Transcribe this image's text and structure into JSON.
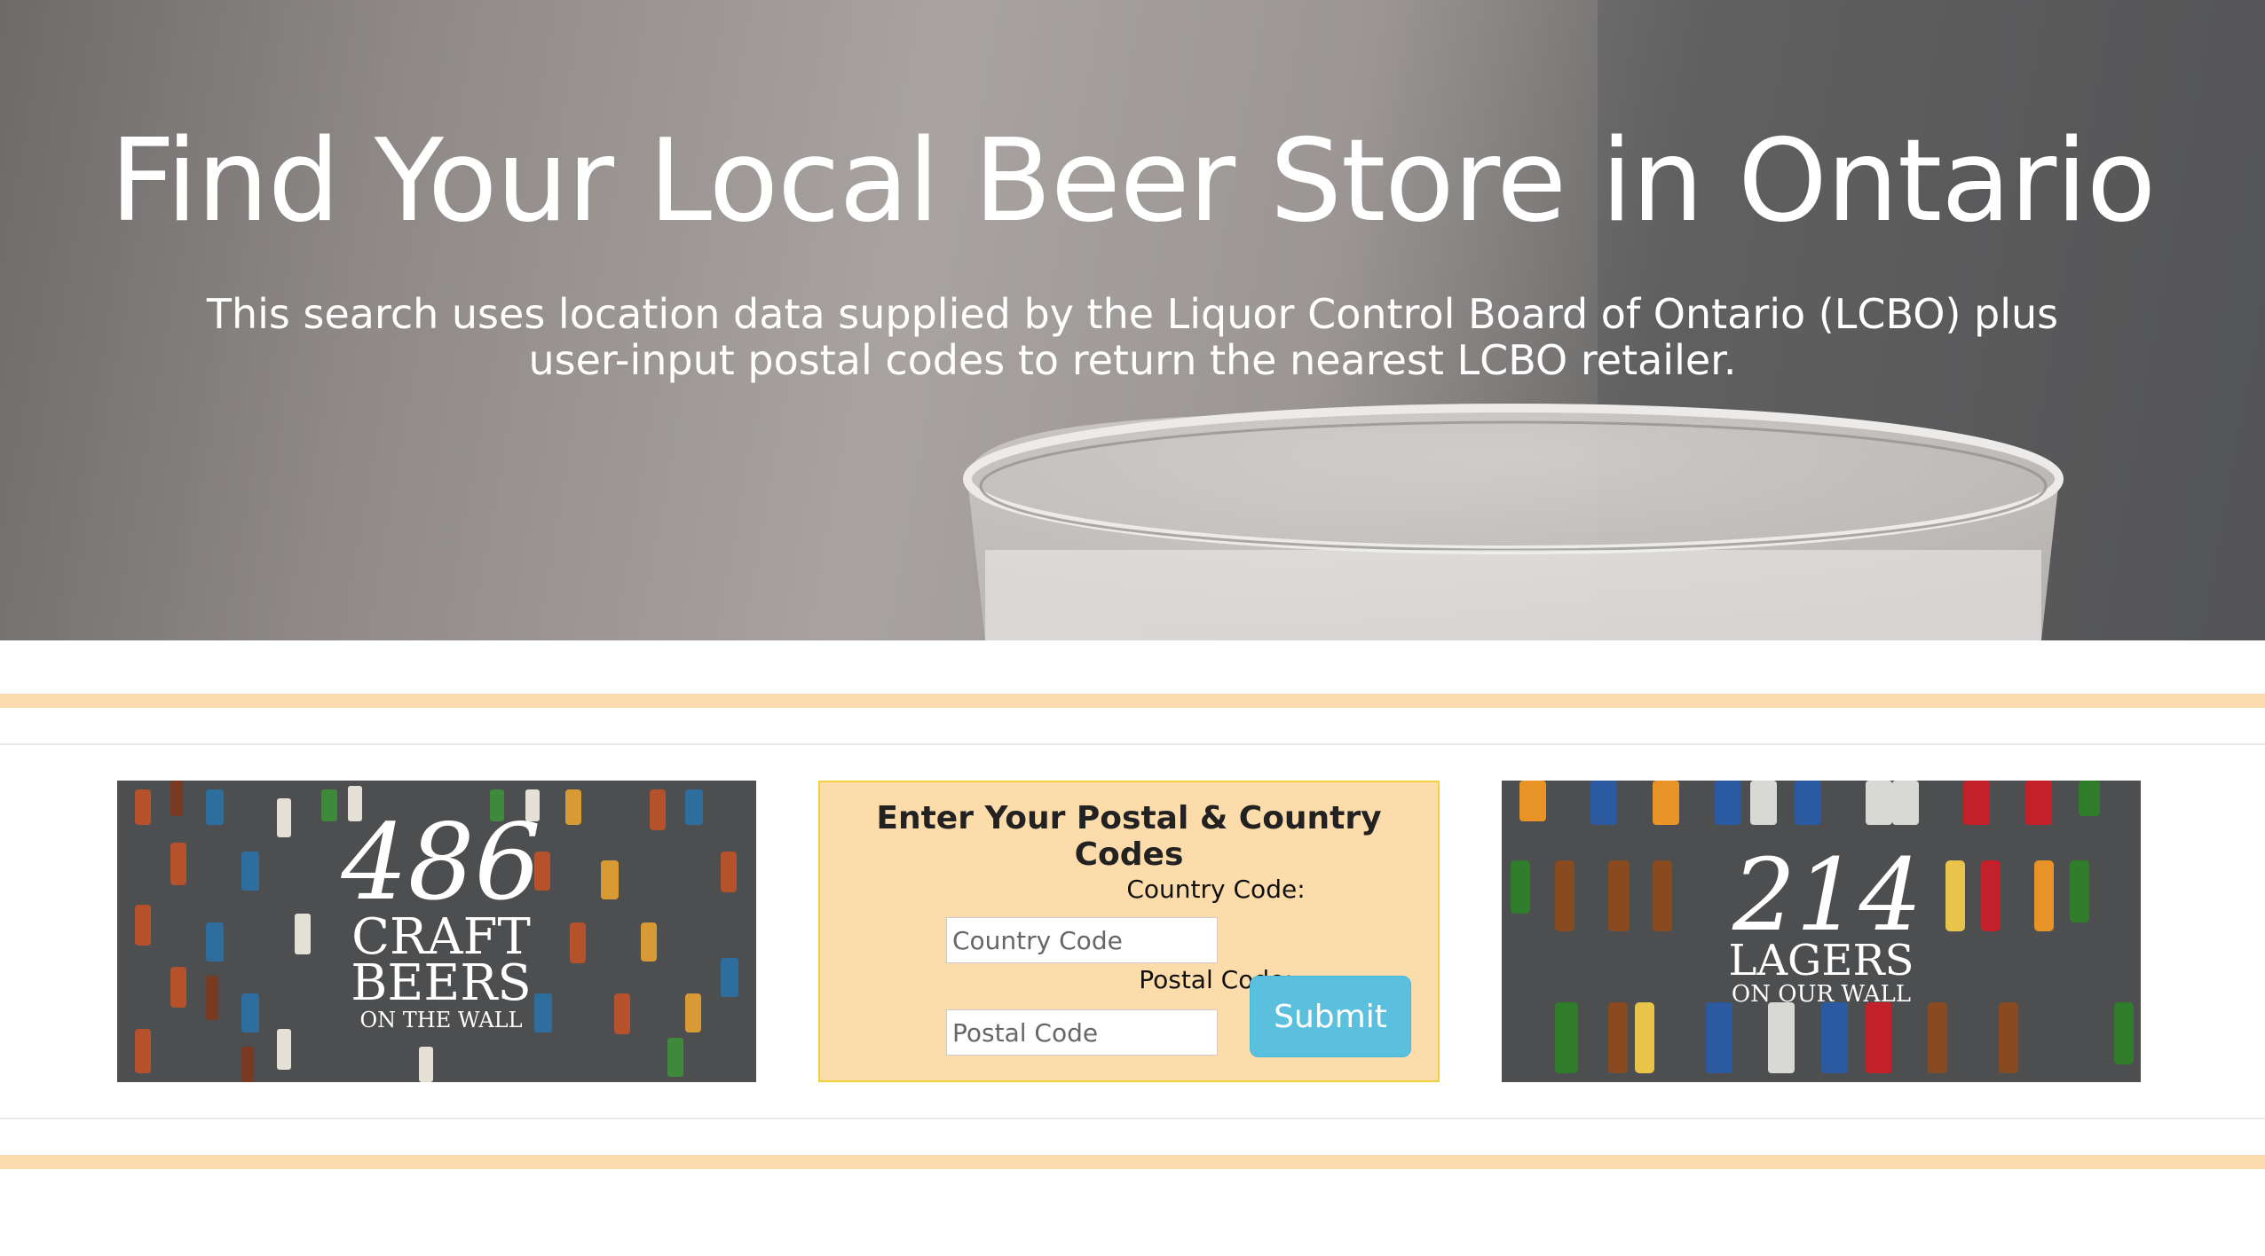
{
  "hero": {
    "title": "Find Your Local Beer Store in Ontario",
    "subtitle": "This search uses location data supplied by the Liquor Control Board of Ontario (LCBO) plus user-input postal codes to return the nearest LCBO retailer."
  },
  "promo_left": {
    "number": "486",
    "line1": "CRAFT",
    "line2": "BEERS",
    "line3": "ON THE WALL"
  },
  "form": {
    "title": "Enter Your Postal & Country Codes",
    "country_label": "Country Code:",
    "country_placeholder": "Country Code",
    "country_value": "",
    "postal_label": "Postal Code:",
    "postal_placeholder": "Postal Code",
    "postal_value": "",
    "submit_label": "Submit"
  },
  "promo_right": {
    "number": "214",
    "line1": "LAGERS",
    "line2": "ON OUR WALL"
  },
  "colors": {
    "stripe": "#fcdcae",
    "form_bg": "#fddcab",
    "form_border": "#f3cf3e",
    "submit_bg": "#5bc0de",
    "promo_bg": "#4f4f4f"
  }
}
